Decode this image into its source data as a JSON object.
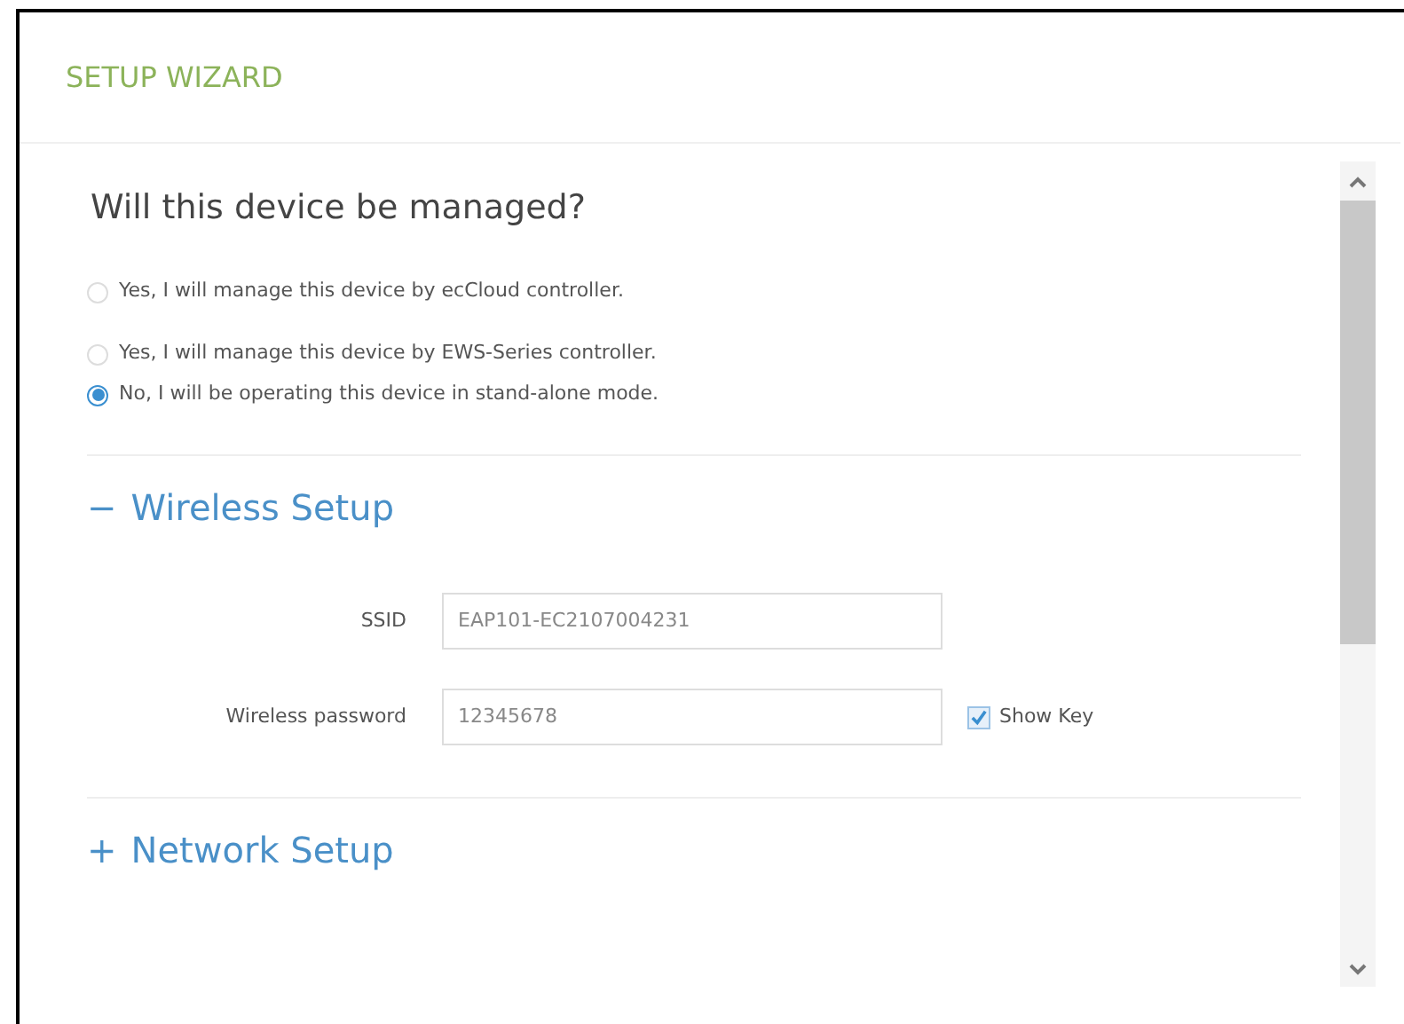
{
  "header": {
    "title": "SETUP WIZARD"
  },
  "question": "Will this device be managed?",
  "options": [
    {
      "label": "Yes, I will manage this device by ecCloud controller.",
      "selected": false
    },
    {
      "label": "Yes, I will manage this device by EWS-Series controller.",
      "selected": false
    },
    {
      "label": "No, I will be operating this device in stand-alone mode.",
      "selected": true
    }
  ],
  "sections": [
    {
      "toggle": "−",
      "title": "Wireless Setup",
      "fields": [
        {
          "label": "SSID",
          "value": "EAP101-EC2107004231"
        },
        {
          "label": "Wireless password",
          "value": "12345678",
          "checkbox": {
            "label": "Show Key",
            "checked": true
          }
        }
      ]
    },
    {
      "toggle": "+",
      "title": "Network Setup"
    }
  ]
}
